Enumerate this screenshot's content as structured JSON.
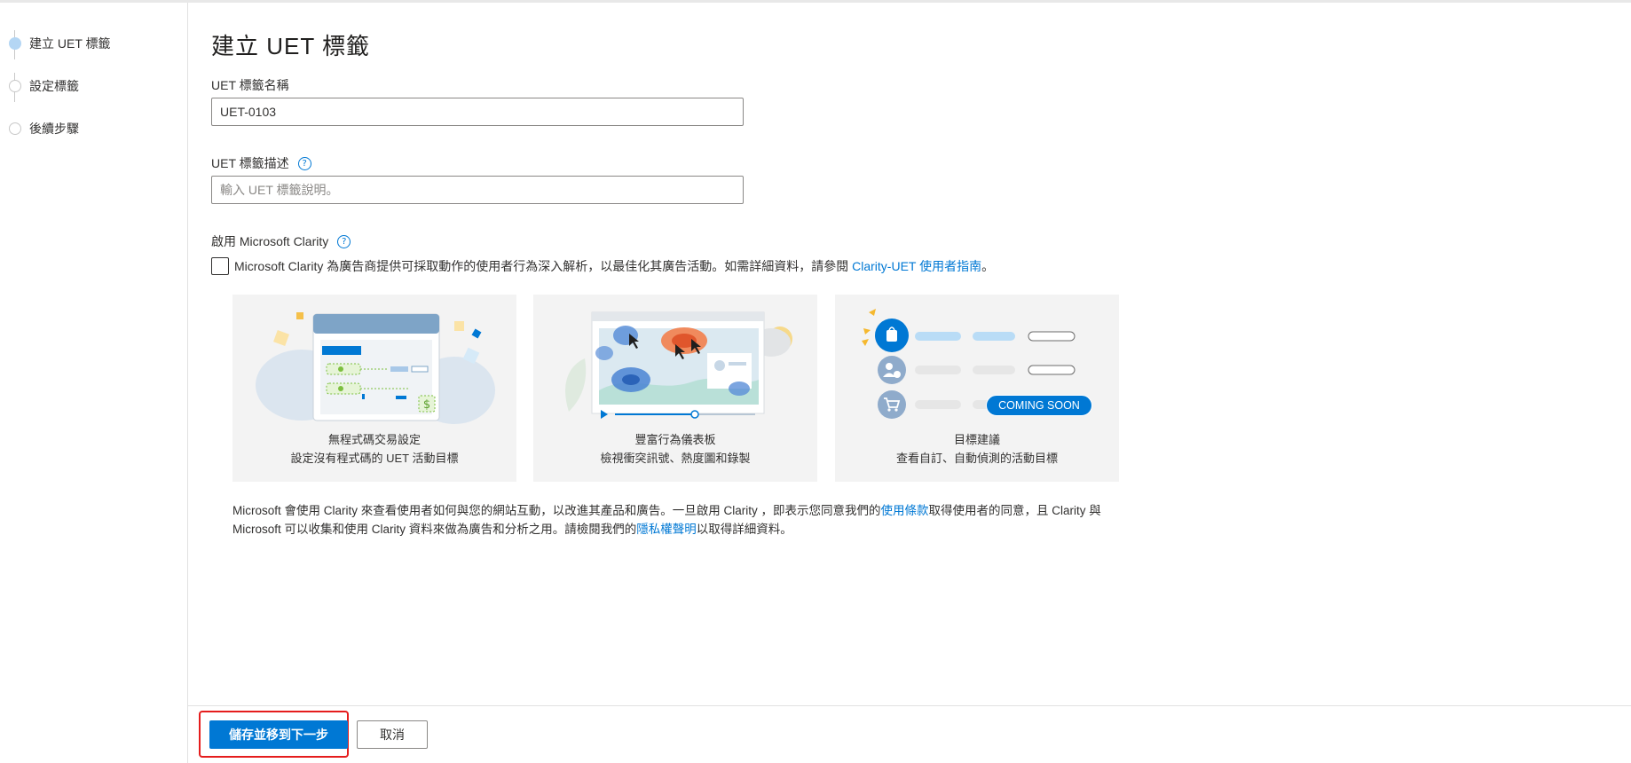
{
  "sidebar": {
    "steps": [
      {
        "label": "建立 UET 標籤",
        "active": true
      },
      {
        "label": "設定標籤",
        "active": false
      },
      {
        "label": "後續步驟",
        "active": false
      }
    ]
  },
  "main": {
    "title": "建立 UET 標籤",
    "name_label": "UET 標籤名稱",
    "name_value": "UET-0103",
    "desc_label": "UET 標籤描述",
    "desc_placeholder": "輸入 UET 標籤說明。",
    "clarity_label": "啟用 Microsoft Clarity",
    "clarity_text": "Microsoft Clarity 為廣告商提供可採取動作的使用者行為深入解析，以最佳化其廣告活動。如需詳細資料，請參閱",
    "clarity_link": "Clarity-UET 使用者指南",
    "clarity_end": "。",
    "cards": [
      {
        "title": "無程式碼交易設定",
        "subtitle": "設定沒有程式碼的 UET 活動目標"
      },
      {
        "title": "豐富行為儀表板",
        "subtitle": "檢視衝突訊號、熱度圖和錄製"
      },
      {
        "title": "目標建議",
        "subtitle": "查看自訂、自動偵測的活動目標",
        "badge": "COMING SOON"
      }
    ],
    "disclaimer_1": "Microsoft 會使用 Clarity 來查看使用者如何與您的網站互動，以改進其產品和廣告。一旦啟用 Clarity ，即表示您同意我們的",
    "terms_link": "使用條款",
    "disclaimer_2": "取得使用者的同意，且 Clarity 與 Microsoft 可以收集和使用 Clarity 資料來做為廣告和分析之用。請檢閱我們的",
    "privacy_link": "隱私權聲明",
    "disclaimer_3": "以取得詳細資料。"
  },
  "footer": {
    "save_label": "儲存並移到下一步",
    "cancel_label": "取消"
  },
  "colors": {
    "accent": "#0078d4",
    "highlight": "#e51d1d",
    "active_step": "#b4d6f4"
  },
  "icons": [
    "help-icon",
    "shopping-bag-icon",
    "user-add-icon",
    "cart-icon",
    "play-icon",
    "cursor-icon",
    "dollar-icon"
  ]
}
